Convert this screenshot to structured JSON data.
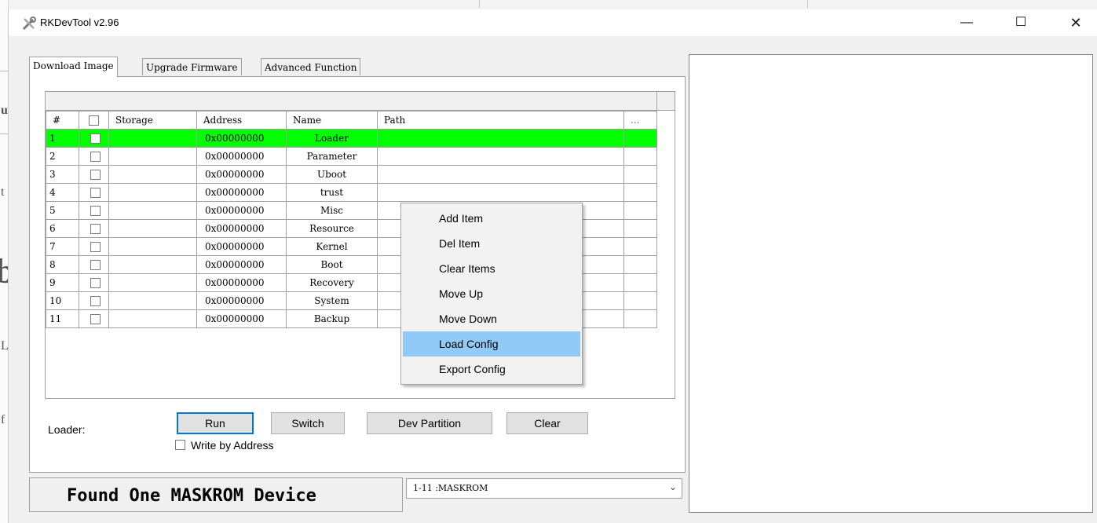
{
  "window": {
    "title": "RKDevTool v2.96",
    "minimize": "—",
    "maximize": "☐",
    "close": "✕"
  },
  "tabs": [
    {
      "label": "Download Image"
    },
    {
      "label": "Upgrade Firmware"
    },
    {
      "label": "Advanced Function"
    }
  ],
  "table": {
    "headers": [
      "#",
      "☐",
      "Storage",
      "Address",
      "Name",
      "Path",
      "..."
    ],
    "rows": [
      {
        "num": "1",
        "address": "0x00000000",
        "name": "Loader"
      },
      {
        "num": "2",
        "address": "0x00000000",
        "name": "Parameter"
      },
      {
        "num": "3",
        "address": "0x00000000",
        "name": "Uboot"
      },
      {
        "num": "4",
        "address": "0x00000000",
        "name": "trust"
      },
      {
        "num": "5",
        "address": "0x00000000",
        "name": "Misc"
      },
      {
        "num": "6",
        "address": "0x00000000",
        "name": "Resource"
      },
      {
        "num": "7",
        "address": "0x00000000",
        "name": "Kernel"
      },
      {
        "num": "8",
        "address": "0x00000000",
        "name": "Boot"
      },
      {
        "num": "9",
        "address": "0x00000000",
        "name": "Recovery"
      },
      {
        "num": "10",
        "address": "0x00000000",
        "name": "System"
      },
      {
        "num": "11",
        "address": "0x00000000",
        "name": "Backup"
      }
    ],
    "selected_row_color": "#00ff00"
  },
  "controls": {
    "loader_label": "Loader:",
    "run": "Run",
    "switch": "Switch",
    "dev_partition": "Dev Partition",
    "clear": "Clear",
    "write_by_address": "Write by Address"
  },
  "status": {
    "message": "Found One MASKROM Device",
    "device": "1-11 :MASKROM"
  },
  "context_menu": {
    "items": [
      "Add Item",
      "Del Item",
      "Clear Items",
      "Move Up",
      "Move Down",
      "Load Config",
      "Export Config"
    ],
    "highlighted": "Load Config",
    "highlight_color": "#91c9f7"
  },
  "background_window": {
    "glyphs": [
      "u",
      "t",
      "b",
      "L",
      "f"
    ]
  }
}
